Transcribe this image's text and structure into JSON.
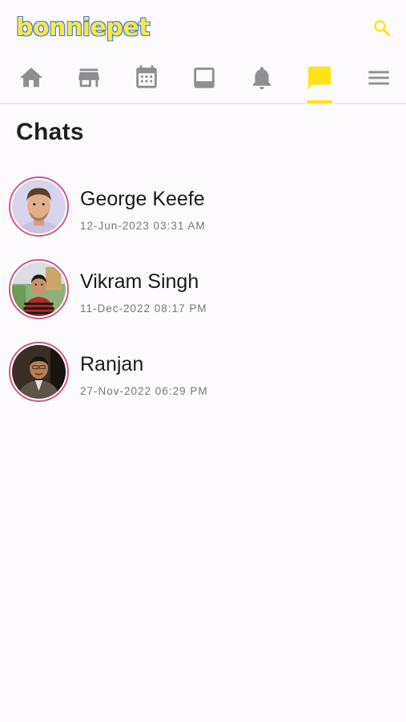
{
  "app": {
    "logo_text": "bonniepet",
    "search_icon": "search-icon"
  },
  "colors": {
    "accent": "#ffe31a",
    "icon_gray": "#8e8e93",
    "logo_fill": "#f5e94a",
    "logo_outline": "#4a7ad6",
    "avatar_ring": "#cf5a86"
  },
  "nav": {
    "items": [
      {
        "id": "home",
        "icon": "home-icon",
        "active": false
      },
      {
        "id": "store",
        "icon": "store-icon",
        "active": false
      },
      {
        "id": "calendar",
        "icon": "calendar-icon",
        "active": false
      },
      {
        "id": "posts",
        "icon": "post-icon",
        "active": false
      },
      {
        "id": "notifications",
        "icon": "bell-icon",
        "active": false
      },
      {
        "id": "chats",
        "icon": "chat-icon",
        "active": true
      },
      {
        "id": "menu",
        "icon": "menu-icon",
        "active": false
      }
    ]
  },
  "page": {
    "title": "Chats"
  },
  "chats": [
    {
      "name": "George Keefe",
      "timestamp": "12-Jun-2023 03:31 AM",
      "avatar": "avatar-george"
    },
    {
      "name": "Vikram Singh",
      "timestamp": "11-Dec-2022 08:17 PM",
      "avatar": "avatar-vikram"
    },
    {
      "name": "Ranjan",
      "timestamp": "27-Nov-2022 06:29 PM",
      "avatar": "avatar-ranjan"
    }
  ]
}
